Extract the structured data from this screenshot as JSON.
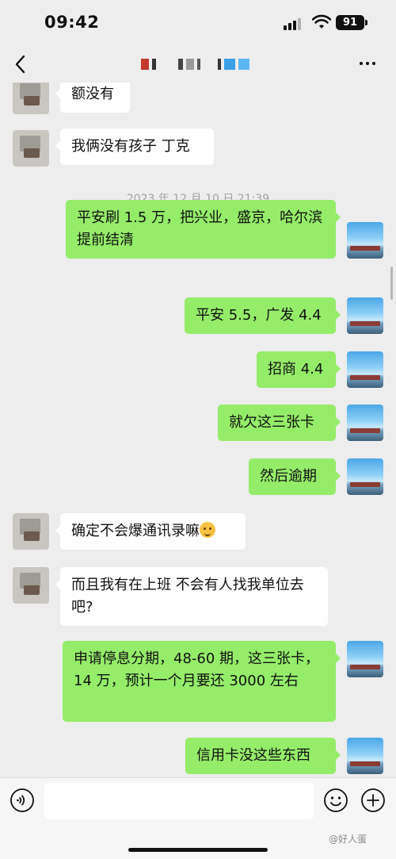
{
  "status_bar": {
    "time": "09:42",
    "battery": "91"
  },
  "nav": {
    "title_redacted": true
  },
  "messages": [
    {
      "side": "left",
      "text": "额没有"
    },
    {
      "side": "left",
      "text": "我俩没有孩子 丁克"
    },
    {
      "type": "timestamp",
      "text": "2023 年 12 月 10 日 21:39"
    },
    {
      "side": "right",
      "text": "平安刷 1.5 万，把兴业，盛京，哈尔滨提前结清"
    },
    {
      "side": "right",
      "text": "平安 5.5，广发 4.4"
    },
    {
      "side": "right",
      "text": "招商 4.4"
    },
    {
      "side": "right",
      "text": "就欠这三张卡"
    },
    {
      "side": "right",
      "text": "然后逾期"
    },
    {
      "side": "left",
      "text": "确定不会爆通讯录嘛"
    },
    {
      "side": "left",
      "text": "而且我有在上班 不会有人找我单位去吧?"
    },
    {
      "side": "right",
      "text": "申请停息分期，48-60 期，这三张卡，14 万，预计一个月要还 3000 左右"
    },
    {
      "side": "right",
      "text": "信用卡没这些东西"
    }
  ],
  "input": {
    "placeholder": ""
  },
  "watermark": "@好人蛋",
  "icons": {
    "back": "chevron-left-icon",
    "more": "ellipsis-icon",
    "voice": "voice-icon",
    "emoji": "emoji-icon",
    "plus": "plus-icon"
  }
}
